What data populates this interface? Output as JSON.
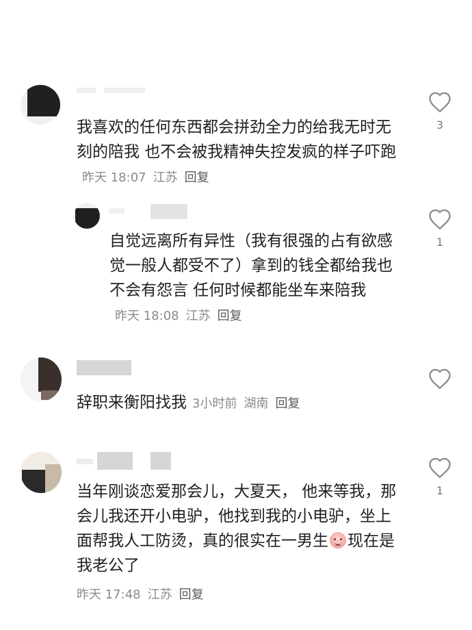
{
  "comments": [
    {
      "text": "我喜欢的任何东西都会拼劲全力的给我无时无刻的陪我 也不会被我精神失控发疯的样子吓跑",
      "time": "昨天 18:07",
      "location": "江苏",
      "reply_label": "回复",
      "likes": "3"
    },
    {
      "text": "自觉远离所有异性（我有很强的占有欲感觉一般人都受不了）拿到的钱全都给我也不会有怨言 任何时候都能坐车来陪我",
      "time": "昨天 18:08",
      "location": "江苏",
      "reply_label": "回复",
      "likes": "1"
    },
    {
      "text": "辞职来衡阳找我",
      "time": "3小时前",
      "location": "湖南",
      "reply_label": "回复",
      "likes": ""
    },
    {
      "text_before": "当年刚谈恋爱那会儿，大夏天， 他来等我，那会儿我还开小电驴，他找到我的小电驴，坐上面帮我人工防烫，真的很实在一男生",
      "emoji": "crying-face-emoji",
      "text_after": "现在是我老公了",
      "time": "昨天 17:48",
      "location": "江苏",
      "reply_label": "回复",
      "likes": "1"
    }
  ],
  "icons": {
    "like": "heart-outline-icon"
  },
  "colors": {
    "text": "#1f1f1f",
    "meta": "#8a8a8a",
    "icon": "#8c8c8c"
  }
}
